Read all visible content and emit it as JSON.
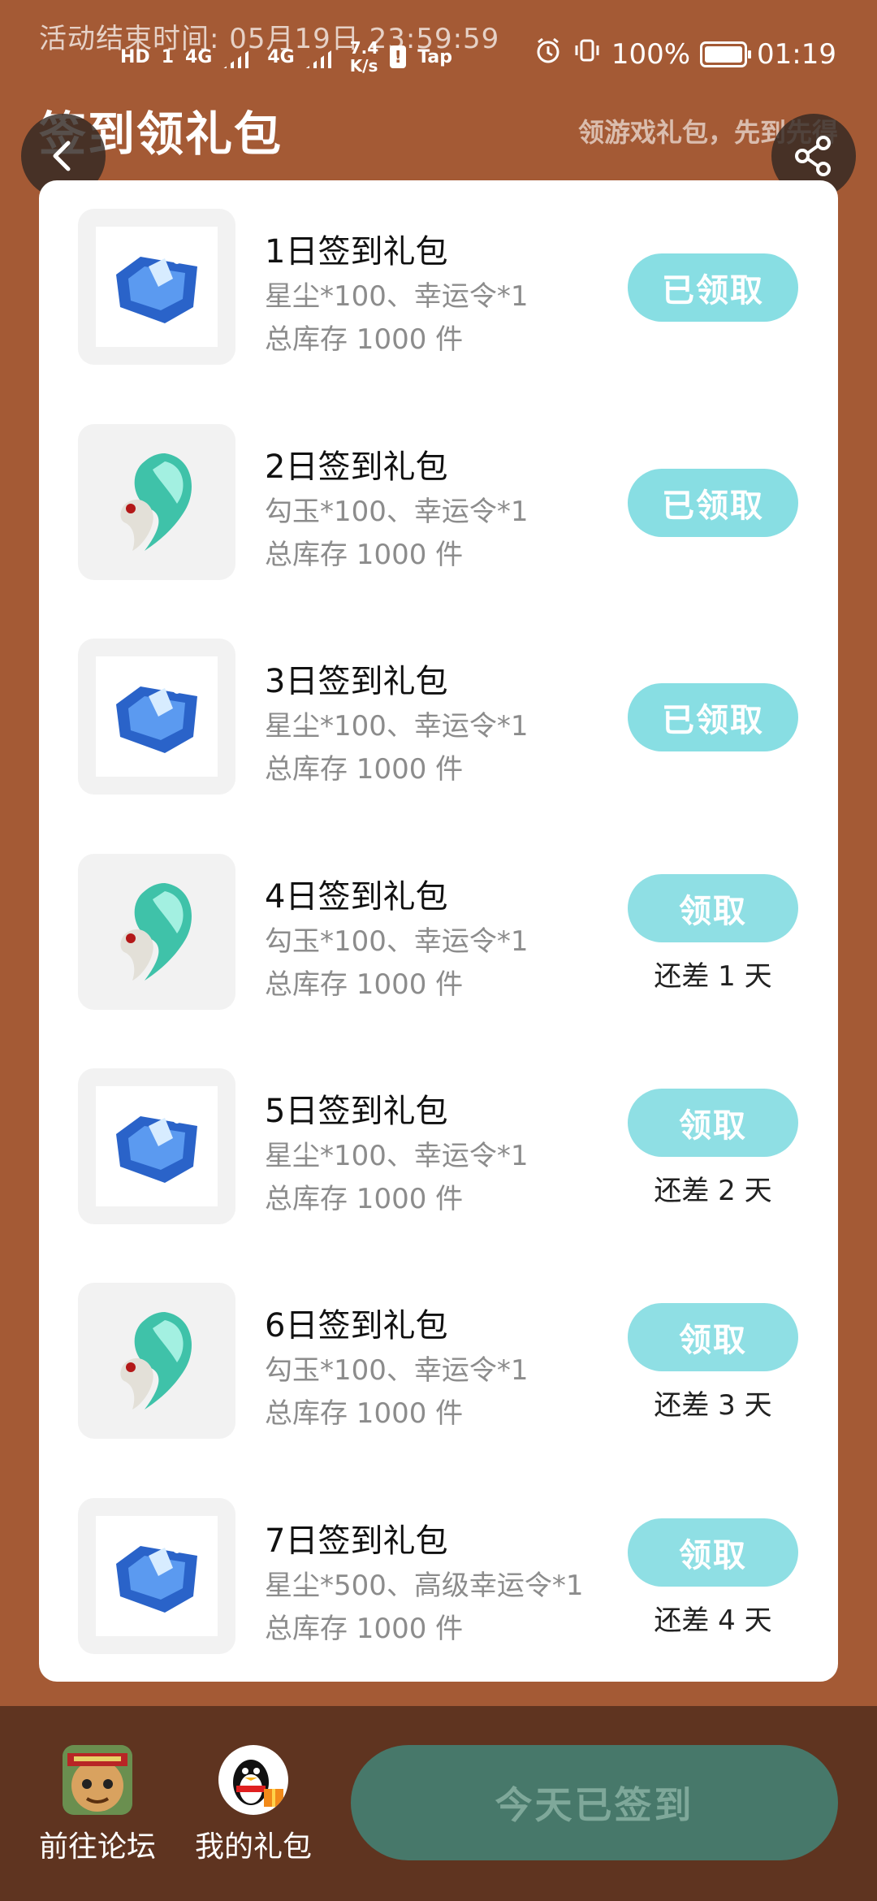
{
  "status_bar": {
    "activity_end": "活动结束时间: 05月19日 23:59:59",
    "hd_badge": "HD",
    "sim_badge": "1",
    "net_left": "4G",
    "net_right": "4G",
    "speed": "7.4\nK/s",
    "tap_label": "Tap",
    "battery_percent": "100%",
    "time": "01:19"
  },
  "header": {
    "title": "签到领礼包",
    "subtitle": "领游戏礼包，先到先得",
    "back_icon": "chevron-left-icon",
    "share_icon": "share-icon"
  },
  "gifts": [
    {
      "title": "1日签到礼包",
      "items": "星尘*100、幸运令*1",
      "stock": "总库存 1000 件",
      "button": "已领取",
      "remaining": "",
      "icon": "star-dust-crystal",
      "status": "claimed"
    },
    {
      "title": "2日签到礼包",
      "items": "勾玉*100、幸运令*1",
      "stock": "总库存 1000 件",
      "button": "已领取",
      "remaining": "",
      "icon": "magatama-jade",
      "status": "claimed"
    },
    {
      "title": "3日签到礼包",
      "items": "星尘*100、幸运令*1",
      "stock": "总库存 1000 件",
      "button": "已领取",
      "remaining": "",
      "icon": "star-dust-crystal",
      "status": "claimed"
    },
    {
      "title": "4日签到礼包",
      "items": "勾玉*100、幸运令*1",
      "stock": "总库存 1000 件",
      "button": "领取",
      "remaining": "还差 1 天",
      "icon": "magatama-jade",
      "status": "pending"
    },
    {
      "title": "5日签到礼包",
      "items": "星尘*100、幸运令*1",
      "stock": "总库存 1000 件",
      "button": "领取",
      "remaining": "还差 2 天",
      "icon": "star-dust-crystal",
      "status": "pending"
    },
    {
      "title": "6日签到礼包",
      "items": "勾玉*100、幸运令*1",
      "stock": "总库存 1000 件",
      "button": "领取",
      "remaining": "还差 3 天",
      "icon": "magatama-jade",
      "status": "pending"
    },
    {
      "title": "7日签到礼包",
      "items": "星尘*500、高级幸运令*1",
      "stock": "总库存 1000 件",
      "button": "领取",
      "remaining": "还差 4 天",
      "icon": "star-dust-crystal",
      "status": "pending"
    }
  ],
  "bottom": {
    "forum_label": "前往论坛",
    "gifts_label": "我的礼包",
    "checkin_label": "今天已签到"
  },
  "colors": {
    "background": "#a45a35",
    "bottom_bar": "#5f3420",
    "claim_button": "#87dde3",
    "checkin_button": "#47786a"
  }
}
